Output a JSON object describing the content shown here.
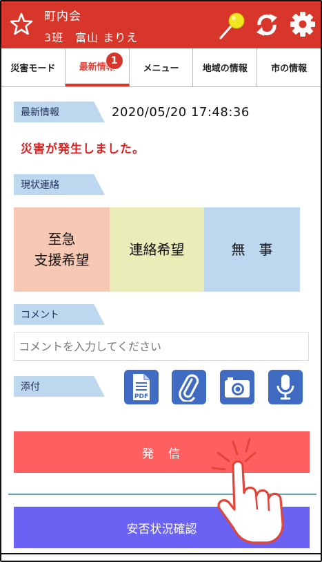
{
  "header": {
    "title": "町内会",
    "subtitle": "3班　富山 まりえ",
    "icons": [
      "star-icon",
      "pin-icon",
      "sync-icon",
      "gear-icon"
    ],
    "color": "#d8362b"
  },
  "tabs": [
    {
      "label": "災害モード",
      "active": false
    },
    {
      "label": "最新情報",
      "active": true,
      "badge": "1"
    },
    {
      "label": "メニュー",
      "active": false
    },
    {
      "label": "地域の情報",
      "active": false
    },
    {
      "label": "市の情報",
      "active": false
    }
  ],
  "latest": {
    "label": "最新情報",
    "datetime": "2020/05/20 17:48:36",
    "message": "災害が発生しました。"
  },
  "status": {
    "label": "現状連絡",
    "urgent_line1": "至急",
    "urgent_line2": "支援希望",
    "contact": "連絡希望",
    "safe": "無　事"
  },
  "comment": {
    "label": "コメント",
    "placeholder": "コメントを入力してください"
  },
  "attach": {
    "label": "添付",
    "icons": [
      "pdf-icon",
      "paperclip-icon",
      "camera-icon",
      "microphone-icon"
    ],
    "pdf_text": "PDF"
  },
  "actions": {
    "send": "発　信",
    "confirm": "安否状況確認"
  },
  "colors": {
    "send": "#ff5f5f",
    "confirm": "#6a62f2",
    "label_bg": "#bdd7ee",
    "alert_text": "#e02020"
  }
}
